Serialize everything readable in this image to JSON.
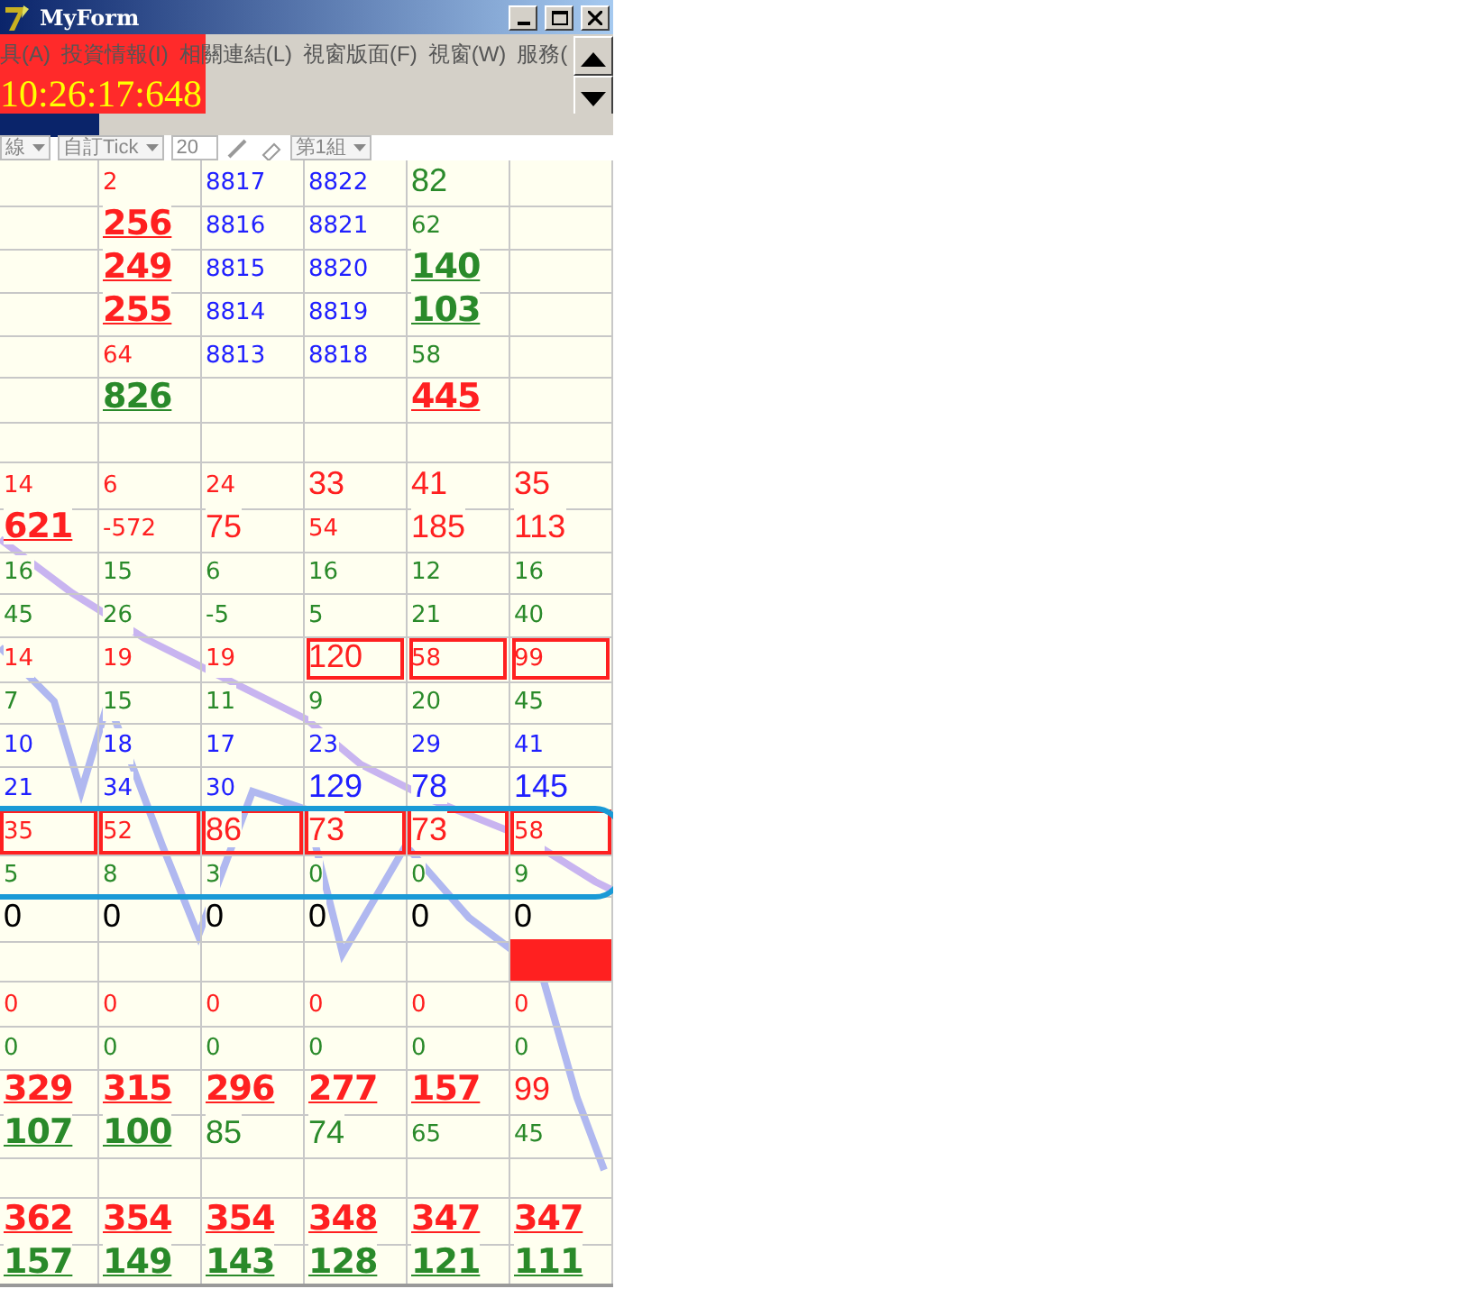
{
  "window": {
    "title": "MyForm"
  },
  "menu": [
    "具(A)",
    "投資情報(I)",
    "相關連結(L)",
    "視窗版面(F)",
    "視窗(W)",
    "服務("
  ],
  "clock": "10:26:17:648",
  "toolbar": [
    {
      "kind": "dropdown",
      "label": "線"
    },
    {
      "kind": "dropdown",
      "label": "自訂Tick"
    },
    {
      "kind": "field",
      "label": "20"
    },
    {
      "kind": "pen"
    },
    {
      "kind": "eraser"
    },
    {
      "kind": "dropdown",
      "label": "第1組"
    }
  ],
  "grid": {
    "rows": [
      {
        "boxed": false,
        "circled": false,
        "cells": [
          null,
          {
            "text": "2",
            "color": "#ff2020",
            "kind": "small"
          },
          {
            "text": "8817",
            "color": "#2020ff",
            "kind": "small"
          },
          {
            "text": "8822",
            "color": "#2020ff",
            "kind": "small"
          },
          {
            "text": "82",
            "color": "#2a8a2a",
            "kind": "large"
          },
          null
        ]
      },
      {
        "boxed": false,
        "circled": false,
        "cells": [
          null,
          {
            "text": "256",
            "color": "#ff2020",
            "kind": "big"
          },
          {
            "text": "8816",
            "color": "#2020ff",
            "kind": "small"
          },
          {
            "text": "8821",
            "color": "#2020ff",
            "kind": "small"
          },
          {
            "text": "62",
            "color": "#2a8a2a",
            "kind": "small"
          },
          null
        ]
      },
      {
        "boxed": false,
        "circled": false,
        "cells": [
          null,
          {
            "text": "249",
            "color": "#ff2020",
            "kind": "big"
          },
          {
            "text": "8815",
            "color": "#2020ff",
            "kind": "small"
          },
          {
            "text": "8820",
            "color": "#2020ff",
            "kind": "small"
          },
          {
            "text": "140",
            "color": "#2a8a2a",
            "kind": "big"
          },
          null
        ]
      },
      {
        "boxed": false,
        "circled": false,
        "cells": [
          null,
          {
            "text": "255",
            "color": "#ff2020",
            "kind": "big"
          },
          {
            "text": "8814",
            "color": "#2020ff",
            "kind": "small"
          },
          {
            "text": "8819",
            "color": "#2020ff",
            "kind": "small"
          },
          {
            "text": "103",
            "color": "#2a8a2a",
            "kind": "big"
          },
          null
        ]
      },
      {
        "boxed": false,
        "circled": false,
        "cells": [
          null,
          {
            "text": "64",
            "color": "#ff2020",
            "kind": "small"
          },
          {
            "text": "8813",
            "color": "#2020ff",
            "kind": "small"
          },
          {
            "text": "8818",
            "color": "#2020ff",
            "kind": "small"
          },
          {
            "text": "58",
            "color": "#2a8a2a",
            "kind": "small"
          },
          null
        ]
      },
      {
        "boxed": false,
        "circled": false,
        "cells": [
          null,
          {
            "text": "826",
            "color": "#2a8a2a",
            "kind": "big"
          },
          null,
          null,
          {
            "text": "445",
            "color": "#ff2020",
            "kind": "big"
          },
          null
        ]
      },
      {
        "boxed": false,
        "circled": false,
        "cells": [
          null,
          null,
          null,
          null,
          null,
          null
        ]
      },
      {
        "boxed": false,
        "circled": false,
        "cells": [
          {
            "text": "14",
            "color": "#ff2020",
            "kind": "small"
          },
          {
            "text": "6",
            "color": "#ff2020",
            "kind": "small"
          },
          {
            "text": "24",
            "color": "#ff2020",
            "kind": "small"
          },
          {
            "text": "33",
            "color": "#ff2020",
            "kind": "large"
          },
          {
            "text": "41",
            "color": "#ff2020",
            "kind": "large"
          },
          {
            "text": "35",
            "color": "#ff2020",
            "kind": "large"
          }
        ]
      },
      {
        "boxed": false,
        "circled": false,
        "cells": [
          {
            "text": "621",
            "color": "#ff2020",
            "kind": "big"
          },
          {
            "text": "-572",
            "color": "#ff2020",
            "kind": "small"
          },
          {
            "text": "75",
            "color": "#ff2020",
            "kind": "large"
          },
          {
            "text": "54",
            "color": "#ff2020",
            "kind": "small"
          },
          {
            "text": "185",
            "color": "#ff2020",
            "kind": "large"
          },
          {
            "text": "113",
            "color": "#ff2020",
            "kind": "large"
          }
        ]
      },
      {
        "boxed": false,
        "circled": false,
        "cells": [
          {
            "text": "16",
            "color": "#2a8a2a",
            "kind": "small"
          },
          {
            "text": "15",
            "color": "#2a8a2a",
            "kind": "small"
          },
          {
            "text": "6",
            "color": "#2a8a2a",
            "kind": "small"
          },
          {
            "text": "16",
            "color": "#2a8a2a",
            "kind": "small"
          },
          {
            "text": "12",
            "color": "#2a8a2a",
            "kind": "small"
          },
          {
            "text": "16",
            "color": "#2a8a2a",
            "kind": "small"
          }
        ]
      },
      {
        "boxed": false,
        "circled": false,
        "cells": [
          {
            "text": "45",
            "color": "#2a8a2a",
            "kind": "small"
          },
          {
            "text": "26",
            "color": "#2a8a2a",
            "kind": "small"
          },
          {
            "text": "-5",
            "color": "#2a8a2a",
            "kind": "small"
          },
          {
            "text": "5",
            "color": "#2a8a2a",
            "kind": "small"
          },
          {
            "text": "21",
            "color": "#2a8a2a",
            "kind": "small"
          },
          {
            "text": "40",
            "color": "#2a8a2a",
            "kind": "small"
          }
        ]
      },
      {
        "boxed": false,
        "circled": false,
        "cells": [
          {
            "text": "14",
            "color": "#ff2020",
            "kind": "small"
          },
          {
            "text": "19",
            "color": "#ff2020",
            "kind": "small"
          },
          {
            "text": "19",
            "color": "#ff2020",
            "kind": "small"
          },
          {
            "text": "120",
            "color": "#ff2020",
            "kind": "large",
            "framed": true
          },
          {
            "text": "58",
            "color": "#ff2020",
            "kind": "small",
            "framed": true
          },
          {
            "text": "99",
            "color": "#ff2020",
            "kind": "small",
            "framed": true
          }
        ]
      },
      {
        "boxed": false,
        "circled": false,
        "cells": [
          {
            "text": "7",
            "color": "#2a8a2a",
            "kind": "small"
          },
          {
            "text": "15",
            "color": "#2a8a2a",
            "kind": "small"
          },
          {
            "text": "11",
            "color": "#2a8a2a",
            "kind": "small"
          },
          {
            "text": "9",
            "color": "#2a8a2a",
            "kind": "small"
          },
          {
            "text": "20",
            "color": "#2a8a2a",
            "kind": "small"
          },
          {
            "text": "45",
            "color": "#2a8a2a",
            "kind": "small"
          }
        ]
      },
      {
        "boxed": false,
        "circled": false,
        "cells": [
          {
            "text": "10",
            "color": "#2020ff",
            "kind": "small"
          },
          {
            "text": "18",
            "color": "#2020ff",
            "kind": "small"
          },
          {
            "text": "17",
            "color": "#2020ff",
            "kind": "small"
          },
          {
            "text": "23",
            "color": "#2020ff",
            "kind": "small"
          },
          {
            "text": "29",
            "color": "#2020ff",
            "kind": "small"
          },
          {
            "text": "41",
            "color": "#2020ff",
            "kind": "small"
          }
        ]
      },
      {
        "boxed": false,
        "circled": false,
        "cells": [
          {
            "text": "21",
            "color": "#2020ff",
            "kind": "small"
          },
          {
            "text": "34",
            "color": "#2020ff",
            "kind": "small"
          },
          {
            "text": "30",
            "color": "#2020ff",
            "kind": "small"
          },
          {
            "text": "129",
            "color": "#2020ff",
            "kind": "large"
          },
          {
            "text": "78",
            "color": "#2020ff",
            "kind": "large"
          },
          {
            "text": "145",
            "color": "#2020ff",
            "kind": "large"
          }
        ]
      },
      {
        "boxed": true,
        "circled": true,
        "cells": [
          {
            "text": "35",
            "color": "#ff2020",
            "kind": "small"
          },
          {
            "text": "52",
            "color": "#ff2020",
            "kind": "small"
          },
          {
            "text": "86",
            "color": "#ff2020",
            "kind": "large"
          },
          {
            "text": "73",
            "color": "#ff2020",
            "kind": "large"
          },
          {
            "text": "73",
            "color": "#ff2020",
            "kind": "large"
          },
          {
            "text": "58",
            "color": "#ff2020",
            "kind": "small"
          }
        ]
      },
      {
        "boxed": false,
        "circled": true,
        "cells": [
          {
            "text": "5",
            "color": "#2a8a2a",
            "kind": "small"
          },
          {
            "text": "8",
            "color": "#2a8a2a",
            "kind": "small"
          },
          {
            "text": "3",
            "color": "#2a8a2a",
            "kind": "small"
          },
          {
            "text": "0",
            "color": "#2a8a2a",
            "kind": "small"
          },
          {
            "text": "0",
            "color": "#2a8a2a",
            "kind": "small"
          },
          {
            "text": "9",
            "color": "#2a8a2a",
            "kind": "small"
          }
        ]
      },
      {
        "boxed": false,
        "circled": false,
        "cells": [
          {
            "text": "0",
            "color": "#000000",
            "kind": "large"
          },
          {
            "text": "0",
            "color": "#000000",
            "kind": "large"
          },
          {
            "text": "0",
            "color": "#000000",
            "kind": "large"
          },
          {
            "text": "0",
            "color": "#000000",
            "kind": "large"
          },
          {
            "text": "0",
            "color": "#000000",
            "kind": "large"
          },
          {
            "text": "0",
            "color": "#000000",
            "kind": "large"
          }
        ]
      },
      {
        "boxed": false,
        "circled": false,
        "cells": [
          null,
          null,
          null,
          null,
          null,
          {
            "kind": "block",
            "color": "#ff2020"
          }
        ]
      },
      {
        "boxed": false,
        "circled": false,
        "cells": [
          {
            "text": "0",
            "color": "#ff2020",
            "kind": "small"
          },
          {
            "text": "0",
            "color": "#ff2020",
            "kind": "small"
          },
          {
            "text": "0",
            "color": "#ff2020",
            "kind": "small"
          },
          {
            "text": "0",
            "color": "#ff2020",
            "kind": "small"
          },
          {
            "text": "0",
            "color": "#ff2020",
            "kind": "small"
          },
          {
            "text": "0",
            "color": "#ff2020",
            "kind": "small"
          }
        ]
      },
      {
        "boxed": false,
        "circled": false,
        "cells": [
          {
            "text": "0",
            "color": "#2a8a2a",
            "kind": "small"
          },
          {
            "text": "0",
            "color": "#2a8a2a",
            "kind": "small"
          },
          {
            "text": "0",
            "color": "#2a8a2a",
            "kind": "small"
          },
          {
            "text": "0",
            "color": "#2a8a2a",
            "kind": "small"
          },
          {
            "text": "0",
            "color": "#2a8a2a",
            "kind": "small"
          },
          {
            "text": "0",
            "color": "#2a8a2a",
            "kind": "small"
          }
        ]
      },
      {
        "boxed": false,
        "circled": false,
        "cells": [
          {
            "text": "329",
            "color": "#ff2020",
            "kind": "big"
          },
          {
            "text": "315",
            "color": "#ff2020",
            "kind": "big"
          },
          {
            "text": "296",
            "color": "#ff2020",
            "kind": "big"
          },
          {
            "text": "277",
            "color": "#ff2020",
            "kind": "big"
          },
          {
            "text": "157",
            "color": "#ff2020",
            "kind": "big"
          },
          {
            "text": "99",
            "color": "#ff2020",
            "kind": "large"
          }
        ]
      },
      {
        "boxed": false,
        "circled": false,
        "cells": [
          {
            "text": "107",
            "color": "#2a8a2a",
            "kind": "big"
          },
          {
            "text": "100",
            "color": "#2a8a2a",
            "kind": "big"
          },
          {
            "text": "85",
            "color": "#2a8a2a",
            "kind": "large"
          },
          {
            "text": "74",
            "color": "#2a8a2a",
            "kind": "large"
          },
          {
            "text": "65",
            "color": "#2a8a2a",
            "kind": "small"
          },
          {
            "text": "45",
            "color": "#2a8a2a",
            "kind": "small"
          }
        ]
      },
      {
        "boxed": false,
        "circled": false,
        "cells": [
          null,
          null,
          null,
          null,
          null,
          null
        ]
      },
      {
        "boxed": false,
        "circled": false,
        "cells": [
          {
            "text": "362",
            "color": "#ff2020",
            "kind": "big"
          },
          {
            "text": "354",
            "color": "#ff2020",
            "kind": "big"
          },
          {
            "text": "354",
            "color": "#ff2020",
            "kind": "big"
          },
          {
            "text": "348",
            "color": "#ff2020",
            "kind": "big"
          },
          {
            "text": "347",
            "color": "#ff2020",
            "kind": "big"
          },
          {
            "text": "347",
            "color": "#ff2020",
            "kind": "big"
          }
        ]
      },
      {
        "boxed": false,
        "circled": false,
        "cells": [
          {
            "text": "157",
            "color": "#2a8a2a",
            "kind": "big"
          },
          {
            "text": "149",
            "color": "#2a8a2a",
            "kind": "big"
          },
          {
            "text": "143",
            "color": "#2a8a2a",
            "kind": "big"
          },
          {
            "text": "128",
            "color": "#2a8a2a",
            "kind": "big"
          },
          {
            "text": "121",
            "color": "#2a8a2a",
            "kind": "big"
          },
          {
            "text": "111",
            "color": "#2a8a2a",
            "kind": "big"
          }
        ]
      }
    ]
  }
}
